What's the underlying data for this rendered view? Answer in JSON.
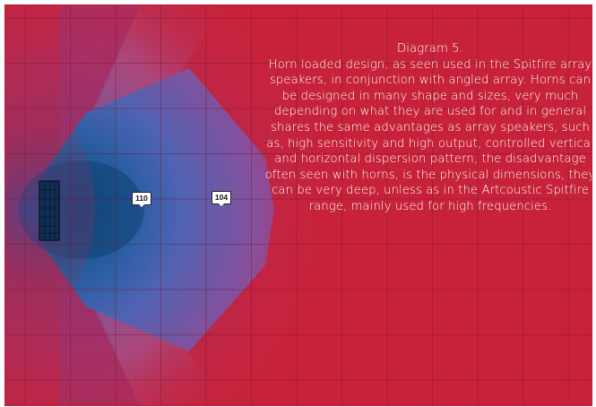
{
  "caption": {
    "title": "Diagram 5.",
    "body": "Horn loaded design, as seen used in the Spitfire array speakers, in conjunction with angled array. Horns can be designed in many shape and sizes, very much depending on what they are used for and in general shares the same advantages as array speakers, such as, high sensitivity and high output, controlled vertical and horizontal dispersion pattern, the disadvantage often seen with horns, is the physical dimensions, they can be very deep, unless as in the Artcoustic Spitfire range, mainly used for high frequencies."
  },
  "markers": [
    {
      "label": "110"
    },
    {
      "label": "104"
    }
  ],
  "colors": {
    "background": "#c8223a",
    "coverage_core": "#1f5f9e",
    "coverage_mid": "#5a5fb4",
    "grid": "#7a1826",
    "text": "#ffffff"
  }
}
